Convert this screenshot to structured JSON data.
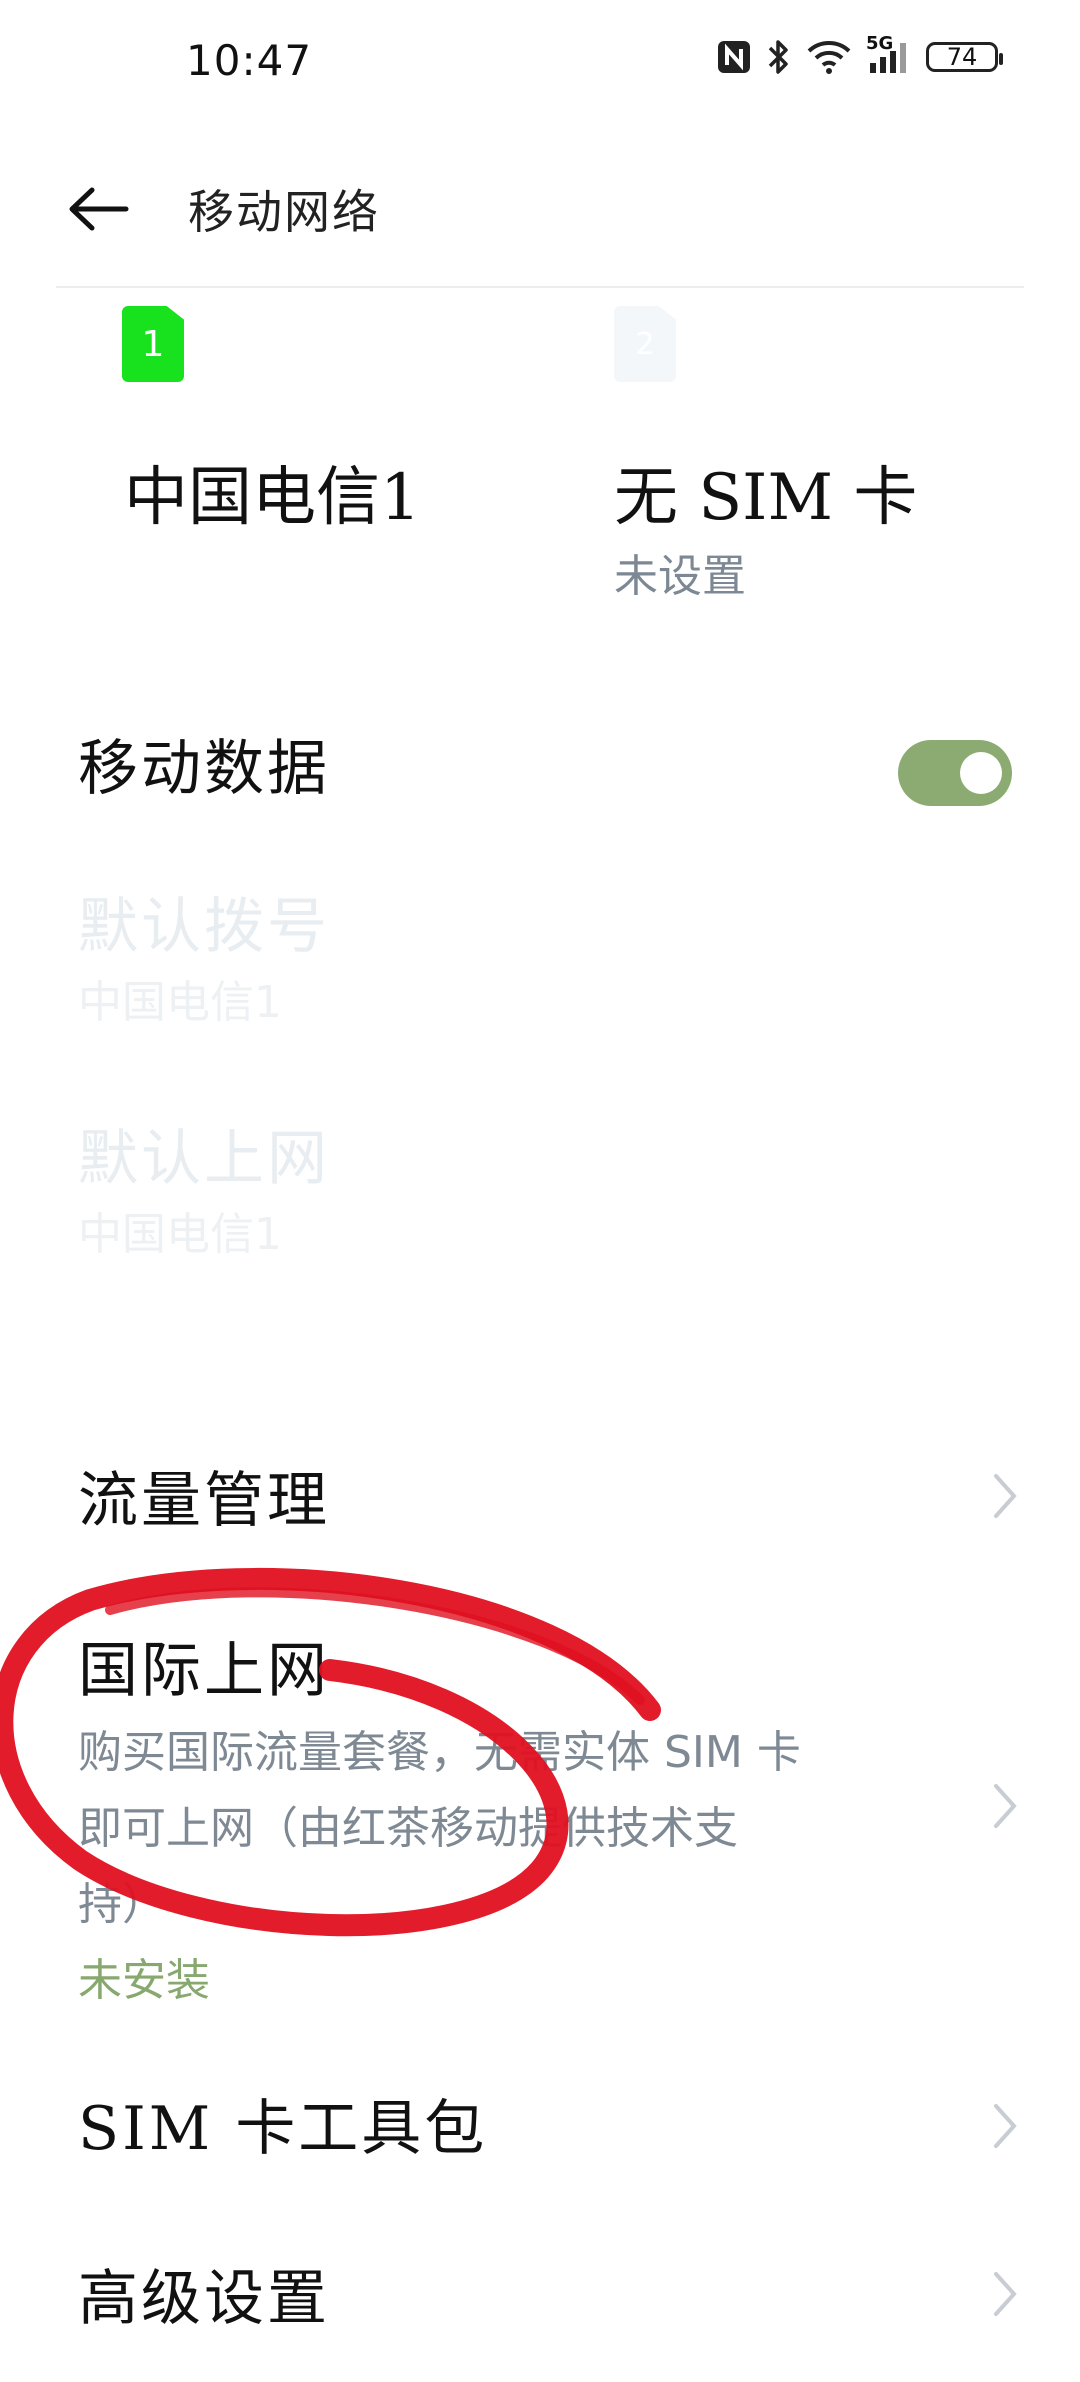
{
  "status": {
    "time": "10:47",
    "network": "5G",
    "battery": "74"
  },
  "appbar": {
    "title": "移动网络"
  },
  "sims": [
    {
      "badge": "1",
      "name": "中国电信1",
      "sub": ""
    },
    {
      "badge": "2",
      "name": "无 SIM 卡",
      "sub": "未设置"
    }
  ],
  "mobile_data": {
    "label": "移动数据",
    "on": true
  },
  "default_call": {
    "label": "默认拨号",
    "value": "中国电信1"
  },
  "default_data": {
    "label": "默认上网",
    "value": "中国电信1"
  },
  "traffic": {
    "label": "流量管理"
  },
  "intl": {
    "label": "国际上网",
    "desc_line1": "购买国际流量套餐，无需实体 SIM 卡",
    "desc_line2": "即可上网（由红茶移动提供技术支",
    "desc_line3": "持）",
    "status": "未安装"
  },
  "toolkit": {
    "label": "SIM 卡工具包"
  },
  "advanced": {
    "label": "高级设置"
  },
  "colors": {
    "accent_green": "#87a86f",
    "sim_green": "#18e21d",
    "annotation_red": "#e01020"
  }
}
